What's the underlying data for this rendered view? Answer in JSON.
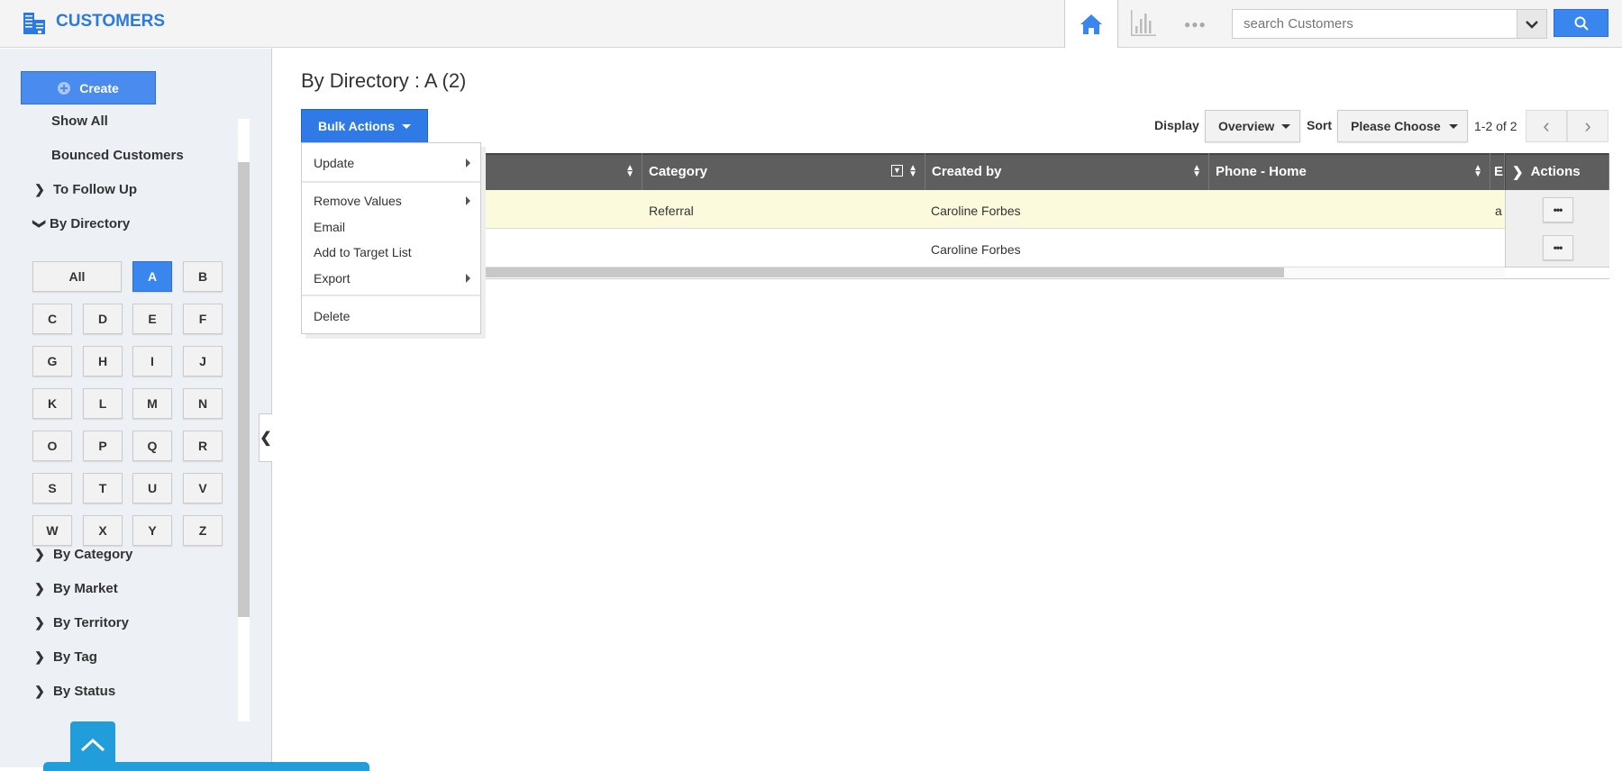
{
  "header": {
    "app_title": "CUSTOMERS",
    "search_placeholder": "search Customers",
    "icons": [
      "building-icon",
      "home-icon",
      "bar-chart-icon",
      "more-dots-icon",
      "chevron-down-icon",
      "search-icon"
    ]
  },
  "sidebar": {
    "create_label": "Create",
    "show_all": "Show All",
    "bounced": "Bounced Customers",
    "to_follow_up": "To Follow Up",
    "by_directory": "By Directory",
    "letters": [
      "All",
      "A",
      "B",
      "C",
      "D",
      "E",
      "F",
      "G",
      "H",
      "I",
      "J",
      "K",
      "L",
      "M",
      "N",
      "O",
      "P",
      "Q",
      "R",
      "S",
      "T",
      "U",
      "V",
      "W",
      "X",
      "Y",
      "Z"
    ],
    "active_letter": "A",
    "groups": [
      "By Category",
      "By Market",
      "By Territory",
      "By Tag",
      "By Status"
    ]
  },
  "main": {
    "title": "By Directory : A (2)",
    "bulk_actions": "Bulk Actions",
    "display_label": "Display",
    "display_value": "Overview",
    "sort_label": "Sort",
    "sort_value": "Please Choose",
    "pagination": "1-2 of 2",
    "menu": {
      "update": "Update",
      "remove_values": "Remove Values",
      "email": "Email",
      "add_to_target": "Add to Target List",
      "export": "Export",
      "delete": "Delete"
    },
    "columns": {
      "category": "Category",
      "created_by": "Created by",
      "phone_home": "Phone - Home",
      "e_clipped": "E",
      "actions": "Actions"
    },
    "rows": [
      {
        "category": "Referral",
        "created_by": "Caroline Forbes",
        "e_clipped": "a",
        "actions": "•••"
      },
      {
        "category": "",
        "created_by": "Caroline Forbes",
        "e_clipped": "",
        "actions": "•••"
      }
    ]
  },
  "colors": {
    "brand": "#2a7ae2",
    "button": "#3a86ef",
    "header_dark": "#5e5e5e",
    "highlight_row": "#fbfadc",
    "scroll_top": "#229ddb"
  }
}
